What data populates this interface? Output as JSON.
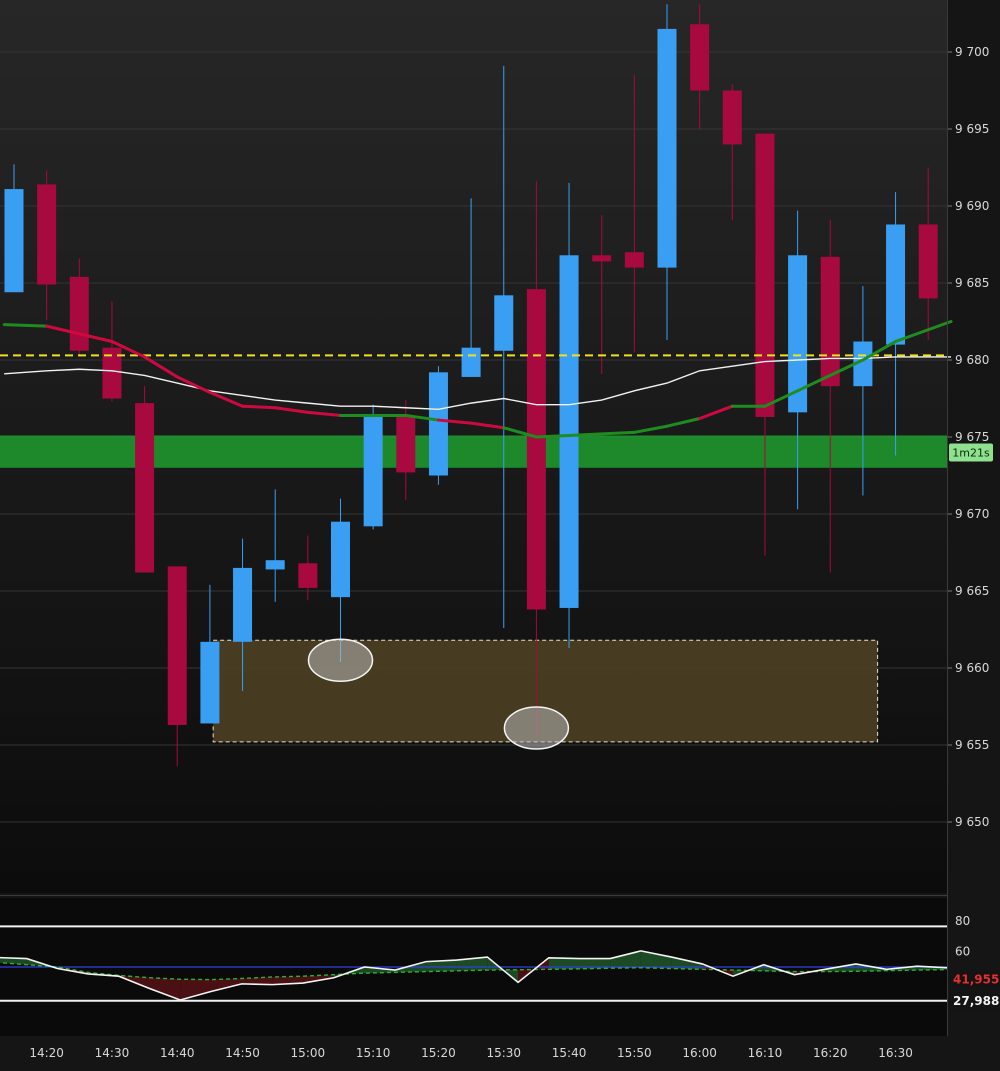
{
  "chart_data": [
    {
      "type": "candlestick",
      "title": "",
      "xlabel": "",
      "ylabel": "",
      "ylim": [
        9645.1,
        9703.1
      ],
      "price_ticks": [
        "9 700",
        "9 695",
        "9 690",
        "9 685",
        "9 680",
        "9 675",
        "9 670",
        "9 665",
        "9 660",
        "9 655",
        "9 650"
      ],
      "price_tick_values": [
        9700,
        9695,
        9690,
        9685,
        9680,
        9675,
        9670,
        9665,
        9660,
        9655,
        9650
      ],
      "time_ticks": [
        "14:20",
        "14:30",
        "14:40",
        "14:50",
        "15:00",
        "15:10",
        "15:20",
        "15:30",
        "15:40",
        "15:50",
        "16:00",
        "16:10",
        "16:20",
        "16:30"
      ],
      "time_tick_index": [
        1,
        3,
        5,
        7,
        9,
        11,
        13,
        15,
        17,
        19,
        21,
        23,
        25,
        27
      ],
      "candle_interval": "5m",
      "candles": [
        {
          "o": 9684.4,
          "h": 9692.7,
          "l": 9685.8,
          "c": 9691.1
        },
        {
          "o": 9691.4,
          "h": 9692.3,
          "l": 9682.6,
          "c": 9684.9
        },
        {
          "o": 9685.4,
          "h": 9686.6,
          "l": 9680.3,
          "c": 9680.6
        },
        {
          "o": 9680.8,
          "h": 9683.8,
          "l": 9677.3,
          "c": 9677.5
        },
        {
          "o": 9677.2,
          "h": 9678.3,
          "l": 9666.2,
          "c": 9666.2
        },
        {
          "o": 9666.6,
          "h": 9666.6,
          "l": 9653.6,
          "c": 9656.3
        },
        {
          "o": 9656.4,
          "h": 9665.4,
          "l": 9656.4,
          "c": 9661.7
        },
        {
          "o": 9661.7,
          "h": 9668.4,
          "l": 9658.5,
          "c": 9666.5
        },
        {
          "o": 9666.4,
          "h": 9671.6,
          "l": 9664.3,
          "c": 9667.0
        },
        {
          "o": 9666.8,
          "h": 9668.6,
          "l": 9664.4,
          "c": 9665.2
        },
        {
          "o": 9664.6,
          "h": 9671.0,
          "l": 9660.4,
          "c": 9669.5
        },
        {
          "o": 9669.2,
          "h": 9677.1,
          "l": 9669.0,
          "c": 9676.4
        },
        {
          "o": 9676.3,
          "h": 9677.4,
          "l": 9670.9,
          "c": 9672.7
        },
        {
          "o": 9672.5,
          "h": 9679.6,
          "l": 9671.9,
          "c": 9679.2
        },
        {
          "o": 9678.9,
          "h": 9690.5,
          "l": 9678.9,
          "c": 9680.8
        },
        {
          "o": 9680.6,
          "h": 9699.1,
          "l": 9662.6,
          "c": 9684.2
        },
        {
          "o": 9684.6,
          "h": 9691.6,
          "l": 9655.6,
          "c": 9663.8
        },
        {
          "o": 9663.9,
          "h": 9691.5,
          "l": 9661.3,
          "c": 9686.8
        },
        {
          "o": 9686.8,
          "h": 9689.4,
          "l": 9679.1,
          "c": 9686.4
        },
        {
          "o": 9687.0,
          "h": 9698.5,
          "l": 9680.5,
          "c": 9686.0
        },
        {
          "o": 9686.0,
          "h": 9703.1,
          "l": 9681.3,
          "c": 9701.5
        },
        {
          "o": 9701.8,
          "h": 9703.1,
          "l": 9695.0,
          "c": 9697.5
        },
        {
          "o": 9697.5,
          "h": 9697.9,
          "l": 9689.1,
          "c": 9694.0
        },
        {
          "o": 9694.7,
          "h": 9694.7,
          "l": 9667.3,
          "c": 9676.3
        },
        {
          "o": 9676.6,
          "h": 9689.7,
          "l": 9670.3,
          "c": 9686.8
        },
        {
          "o": 9686.7,
          "h": 9689.1,
          "l": 9666.2,
          "c": 9678.3
        },
        {
          "o": 9678.3,
          "h": 9684.8,
          "l": 9671.2,
          "c": 9681.2
        },
        {
          "o": 9681.0,
          "h": 9690.9,
          "l": 9673.8,
          "c": 9688.8
        },
        {
          "o": 9688.8,
          "h": 9692.5,
          "l": 9681.3,
          "c": 9684.0
        }
      ],
      "overlays": {
        "moving_average": {
          "colors": {
            "down": "#cc0a40",
            "up": "#1e8c1e"
          },
          "points": [
            {
              "i": -0.3,
              "v": 9682.3,
              "t": "up"
            },
            {
              "i": 1,
              "v": 9682.2,
              "t": "up"
            },
            {
              "i": 3,
              "v": 9681.2,
              "t": "down"
            },
            {
              "i": 4,
              "v": 9680.2,
              "t": "down"
            },
            {
              "i": 5,
              "v": 9678.9,
              "t": "down"
            },
            {
              "i": 6,
              "v": 9677.9,
              "t": "down"
            },
            {
              "i": 7,
              "v": 9677.0,
              "t": "down"
            },
            {
              "i": 8,
              "v": 9676.9,
              "t": "down"
            },
            {
              "i": 9,
              "v": 9676.6,
              "t": "down"
            },
            {
              "i": 10,
              "v": 9676.4,
              "t": "down"
            },
            {
              "i": 11,
              "v": 9676.4,
              "t": "up"
            },
            {
              "i": 12,
              "v": 9676.4,
              "t": "up"
            },
            {
              "i": 13,
              "v": 9676.1,
              "t": "up"
            },
            {
              "i": 14,
              "v": 9675.9,
              "t": "down"
            },
            {
              "i": 15,
              "v": 9675.6,
              "t": "down"
            },
            {
              "i": 16,
              "v": 9675.0,
              "t": "up"
            },
            {
              "i": 17,
              "v": 9675.1,
              "t": "up"
            },
            {
              "i": 18,
              "v": 9675.2,
              "t": "up"
            },
            {
              "i": 19,
              "v": 9675.3,
              "t": "up"
            },
            {
              "i": 20,
              "v": 9675.7,
              "t": "up"
            },
            {
              "i": 21,
              "v": 9676.2,
              "t": "up"
            },
            {
              "i": 22,
              "v": 9677.0,
              "t": "down"
            },
            {
              "i": 23,
              "v": 9677.0,
              "t": "up"
            },
            {
              "i": 24,
              "v": 9678.0,
              "t": "up"
            },
            {
              "i": 25,
              "v": 9679.0,
              "t": "up"
            },
            {
              "i": 26,
              "v": 9680.0,
              "t": "up"
            },
            {
              "i": 27,
              "v": 9681.2,
              "t": "up"
            },
            {
              "i": 28.7,
              "v": 9682.5,
              "t": "up"
            }
          ]
        },
        "vwap_line": {
          "color": "#f2f2f2",
          "points": [
            {
              "i": -0.3,
              "v": 9679.1
            },
            {
              "i": 1,
              "v": 9679.3
            },
            {
              "i": 2,
              "v": 9679.4
            },
            {
              "i": 3,
              "v": 9679.3
            },
            {
              "i": 4,
              "v": 9679.0
            },
            {
              "i": 5,
              "v": 9678.5
            },
            {
              "i": 6,
              "v": 9678.0
            },
            {
              "i": 7,
              "v": 9677.7
            },
            {
              "i": 8,
              "v": 9677.4
            },
            {
              "i": 9,
              "v": 9677.2
            },
            {
              "i": 10,
              "v": 9677.0
            },
            {
              "i": 11,
              "v": 9677.0
            },
            {
              "i": 12,
              "v": 9676.9
            },
            {
              "i": 13,
              "v": 9676.8
            },
            {
              "i": 14,
              "v": 9677.2
            },
            {
              "i": 15,
              "v": 9677.5
            },
            {
              "i": 16,
              "v": 9677.1
            },
            {
              "i": 17,
              "v": 9677.1
            },
            {
              "i": 18,
              "v": 9677.4
            },
            {
              "i": 19,
              "v": 9678.0
            },
            {
              "i": 20,
              "v": 9678.5
            },
            {
              "i": 21,
              "v": 9679.3
            },
            {
              "i": 22,
              "v": 9679.6
            },
            {
              "i": 23,
              "v": 9679.9
            },
            {
              "i": 24,
              "v": 9680.0
            },
            {
              "i": 25,
              "v": 9680.1
            },
            {
              "i": 26,
              "v": 9680.1
            },
            {
              "i": 27,
              "v": 9680.2
            },
            {
              "i": 28.7,
              "v": 9680.2
            }
          ]
        },
        "dashed_level": {
          "value": 9680.3,
          "color": "#f0e020"
        },
        "zone": {
          "low": 9673.0,
          "high": 9675.1,
          "color": "#1e9e2e",
          "label": "1m21s"
        },
        "box": {
          "i_start": 6.1,
          "i_end": 26.45,
          "low": 9655.2,
          "high": 9661.8,
          "color": "#4a3d22"
        },
        "markers": [
          {
            "i": 10,
            "v": 9660.5
          },
          {
            "i": 16,
            "v": 9656.1
          }
        ]
      },
      "colors": {
        "up": "#3a9ff2",
        "down": "#a8093e",
        "background": "#1a1a1a",
        "grid": "#343434"
      }
    },
    {
      "type": "line",
      "title": "",
      "ylim": [
        5,
        95
      ],
      "y_ticks": [
        "80",
        "60"
      ],
      "y_tick_values": [
        80,
        60
      ],
      "levels": [
        76.5,
        27.988
      ],
      "level_label": "27,988",
      "signal_value": 41.955,
      "signal_label": "41,955",
      "signal_color": "#e53030",
      "baseline_value": 50.0,
      "baseline_color": "#3040e0",
      "series": [
        {
          "values": [
            56.2,
            55.5,
            49.0,
            45.5,
            44.0,
            36.0,
            28.5,
            34.0,
            39.0,
            38.5,
            39.5,
            43.0,
            50.0,
            48.0,
            53.5,
            54.5,
            56.5,
            40.0,
            56.0,
            55.5,
            55.5,
            60.5,
            56.5,
            52.0,
            44.0,
            51.5,
            45.0,
            48.5,
            52.0,
            48.5,
            50.5,
            49.5
          ]
        },
        {
          "values": [
            53.0,
            51.5,
            50.0,
            46.5,
            44.5,
            43.0,
            42.0,
            41.8,
            42.5,
            43.5,
            44.0,
            45.0,
            46.0,
            46.5,
            47.0,
            47.5,
            48.0,
            48.2,
            48.5,
            48.8,
            49.2,
            49.5,
            49.0,
            48.5,
            48.0,
            47.5,
            47.0,
            47.0,
            47.2,
            47.6,
            48.0,
            48.3
          ]
        }
      ],
      "fill_colors": {
        "above": "#1c4a24",
        "below": "#4a1014"
      }
    }
  ]
}
